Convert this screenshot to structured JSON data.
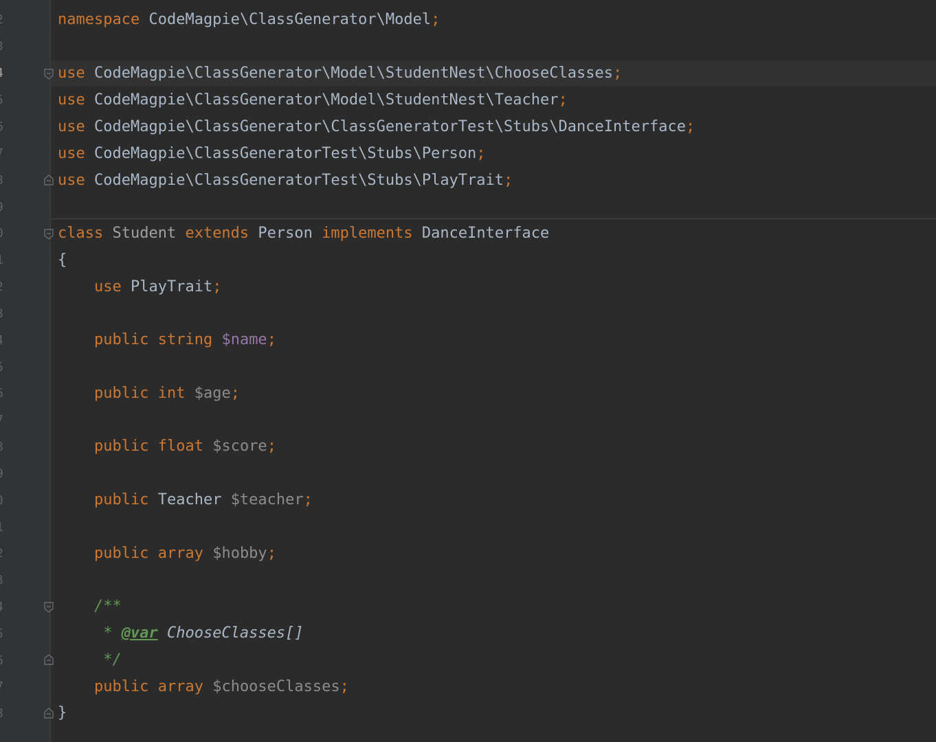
{
  "gutter": {
    "line_numbers": [
      "2",
      "3",
      "4",
      "5",
      "6",
      "7",
      "8",
      "9",
      "0",
      "1",
      "2",
      "3",
      "4",
      "5",
      "6",
      "7",
      "8",
      "9",
      "0",
      "1",
      "2",
      "3",
      "4",
      "5",
      "6",
      "7",
      "8"
    ]
  },
  "code": {
    "ns_kw": "namespace",
    "ns_name": "CodeMagpie\\ClassGenerator\\Model",
    "semicolon": ";",
    "use_kw": "use",
    "uses": [
      "CodeMagpie\\ClassGenerator\\Model\\StudentNest\\ChooseClasses",
      "CodeMagpie\\ClassGenerator\\Model\\StudentNest\\Teacher",
      "CodeMagpie\\ClassGenerator\\ClassGeneratorTest\\Stubs\\DanceInterface",
      "CodeMagpie\\ClassGeneratorTest\\Stubs\\Person",
      "CodeMagpie\\ClassGeneratorTest\\Stubs\\PlayTrait"
    ],
    "class_kw": "class",
    "class_name": "Student",
    "extends_kw": "extends",
    "parent": "Person",
    "implements_kw": "implements",
    "interface": "DanceInterface",
    "open_brace": "{",
    "close_brace": "}",
    "trait_use_kw": "use",
    "trait_name": "PlayTrait",
    "public_kw": "public",
    "prop1_type": "string",
    "prop1_name": "$name",
    "prop2_type": "int",
    "prop2_name": "$age",
    "prop3_type": "float",
    "prop3_name": "$score",
    "prop4_type": "Teacher",
    "prop4_name": "$teacher",
    "prop5_type": "array",
    "prop5_name": "$hobby",
    "doc_open": "/**",
    "doc_star": " * ",
    "doc_tag": "@var",
    "doc_type": " ChooseClasses[]",
    "doc_close": " */",
    "prop6_type": "array",
    "prop6_name": "$chooseClasses"
  }
}
